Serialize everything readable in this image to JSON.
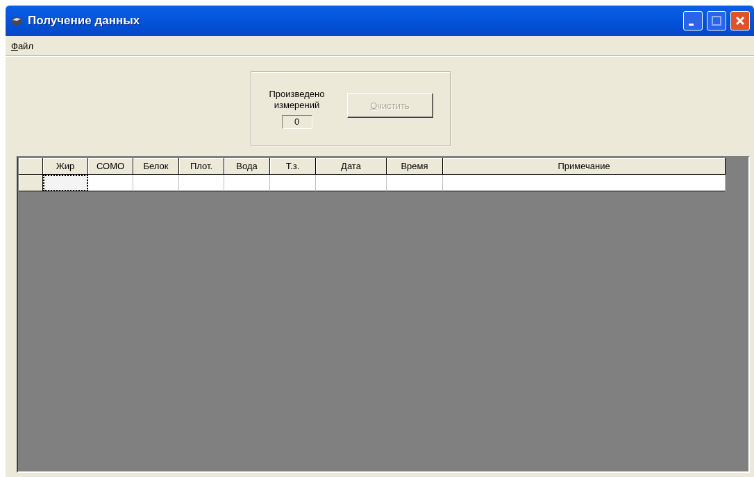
{
  "window": {
    "title": "Получение данных"
  },
  "menu": [
    {
      "label": "Файл"
    }
  ],
  "counter": {
    "label": "Произведено измерений",
    "value": "0"
  },
  "clear_button": {
    "label": "Очистить",
    "disabled": true
  },
  "table": {
    "columns": [
      "Жир",
      "СОМО",
      "Белок",
      "Плот.",
      "Вода",
      "Т.з.",
      "Дата",
      "Время",
      "Примечание"
    ],
    "rows": [
      {
        "cells": [
          {
            "selected": true
          },
          {
            "selected": false
          },
          {
            "selected": false
          },
          {
            "selected": false
          },
          {
            "selected": false
          },
          {
            "selected": false
          },
          {
            "selected": false
          },
          {
            "selected": false
          },
          {
            "selected": false
          }
        ]
      }
    ]
  }
}
